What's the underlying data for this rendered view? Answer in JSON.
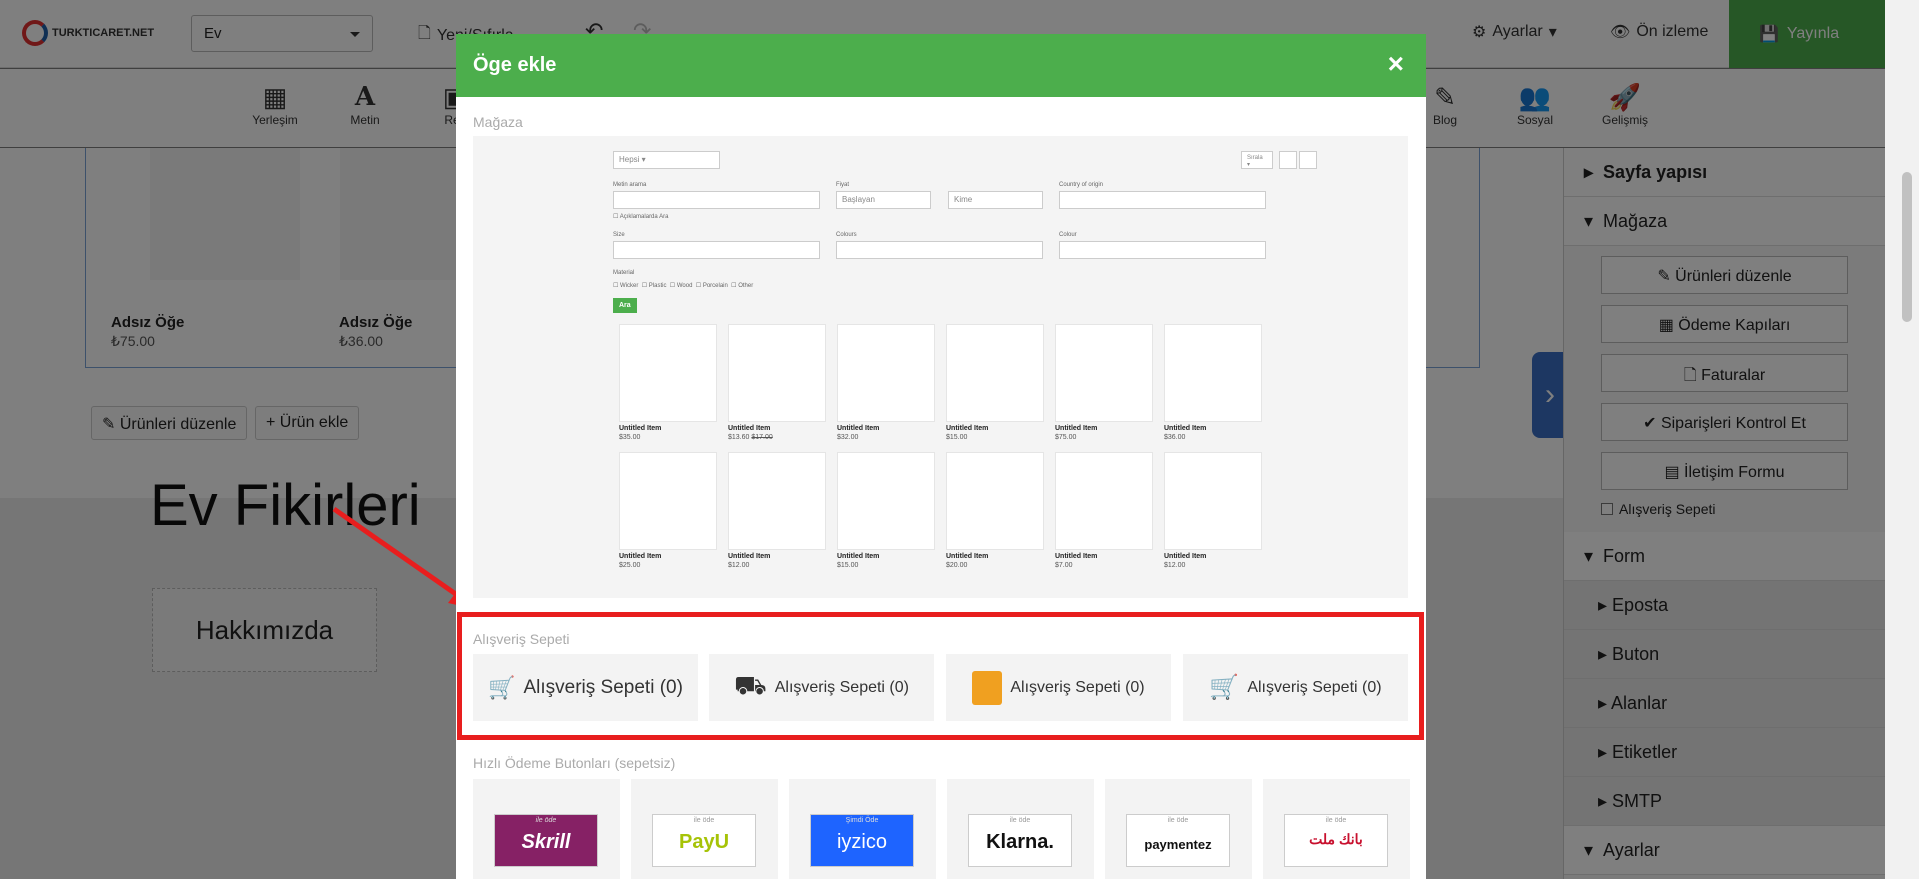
{
  "topbar": {
    "logo": "TURKTICARET.NET",
    "page_select": "Ev",
    "new_save": "Yeni/Sıfırla",
    "settings": "Ayarlar",
    "preview": "Ön izleme",
    "publish": "Yayınla"
  },
  "tools": [
    "Yerleşim",
    "Metin",
    "Res",
    "Blog",
    "Sosyal",
    "Gelişmiş"
  ],
  "canvas": {
    "products": [
      {
        "name": "Adsız Öğe",
        "price": "₺75.00"
      },
      {
        "name": "Adsız Öğe",
        "price": "₺36.00"
      }
    ],
    "edit_products": "Ürünleri düzenle",
    "add_product": "Ürün ekle",
    "hero_title": "Ev Fikirleri",
    "about": "Hakkımızda"
  },
  "right_panel": {
    "site_structure": "Sayfa yapısı",
    "store": "Mağaza",
    "store_buttons": [
      "Ürünleri düzenle",
      "Ödeme Kapıları",
      "Faturalar",
      "Siparişleri Kontrol Et",
      "İletişim Formu"
    ],
    "cart_checkbox": "Alışveriş Sepeti",
    "form": "Form",
    "form_items": [
      "Eposta",
      "Buton",
      "Alanlar",
      "Etiketler",
      "SMTP"
    ],
    "settings": "Ayarlar"
  },
  "modal": {
    "title": "Öge ekle",
    "close": "×",
    "store_label": "Mağaza",
    "preview": {
      "filter_select": "Hepsi",
      "sort": "Sırala",
      "search_label": "Metin arama",
      "price_label": "Fiyat",
      "price_from": "Başlayan",
      "price_to": "Kime",
      "country_label": "Country of origin",
      "desc_search": "Açıklamalarda Ara",
      "size_label": "Size",
      "colours_label": "Colours",
      "colour_label": "Colour",
      "material_label": "Material",
      "materials": [
        "Wicker",
        "Plastic",
        "Wood",
        "Porcelain",
        "Other"
      ],
      "search_btn": "Ara",
      "items": [
        {
          "name": "Untitled Item",
          "price": "$35.00"
        },
        {
          "name": "Untitled Item",
          "price": "$13.60",
          "old": "$17.00"
        },
        {
          "name": "Untitled Item",
          "price": "$32.00"
        },
        {
          "name": "Untitled Item",
          "price": "$15.00"
        },
        {
          "name": "Untitled Item",
          "price": "$75.00"
        },
        {
          "name": "Untitled Item",
          "price": "$36.00"
        },
        {
          "name": "Untitled Item",
          "price": "$25.00"
        },
        {
          "name": "Untitled Item",
          "price": "$12.00"
        },
        {
          "name": "Untitled Item",
          "price": "$15.00"
        },
        {
          "name": "Untitled Item",
          "price": "$20.00"
        },
        {
          "name": "Untitled Item",
          "price": "$7.00"
        },
        {
          "name": "Untitled Item",
          "price": "$12.00"
        }
      ]
    },
    "cart_label": "Alışveriş Sepeti",
    "cart_options": [
      "Alışveriş Sepeti (0)",
      "Alışveriş Sepeti (0)",
      "Alışveriş Sepeti (0)",
      "Alışveriş Sepeti (0)"
    ],
    "quick_pay_label": "Hızlı Ödeme Butonları (sepetsiz)",
    "pay_options": [
      {
        "tag": "ile öde",
        "name": "Skrill"
      },
      {
        "tag": "ile öde",
        "name": "PayU"
      },
      {
        "tag": "Şimdi Öde",
        "name": "iyzico"
      },
      {
        "tag": "ile öde",
        "name": "Klarna."
      },
      {
        "tag": "ile öde",
        "name": "paymentez"
      },
      {
        "tag": "ile öde",
        "name": "بانك ملت"
      }
    ]
  },
  "colors": {
    "accent_green": "#4cae4c",
    "highlight_red": "#e81e1e",
    "panel_blue": "#3b6fc4"
  }
}
